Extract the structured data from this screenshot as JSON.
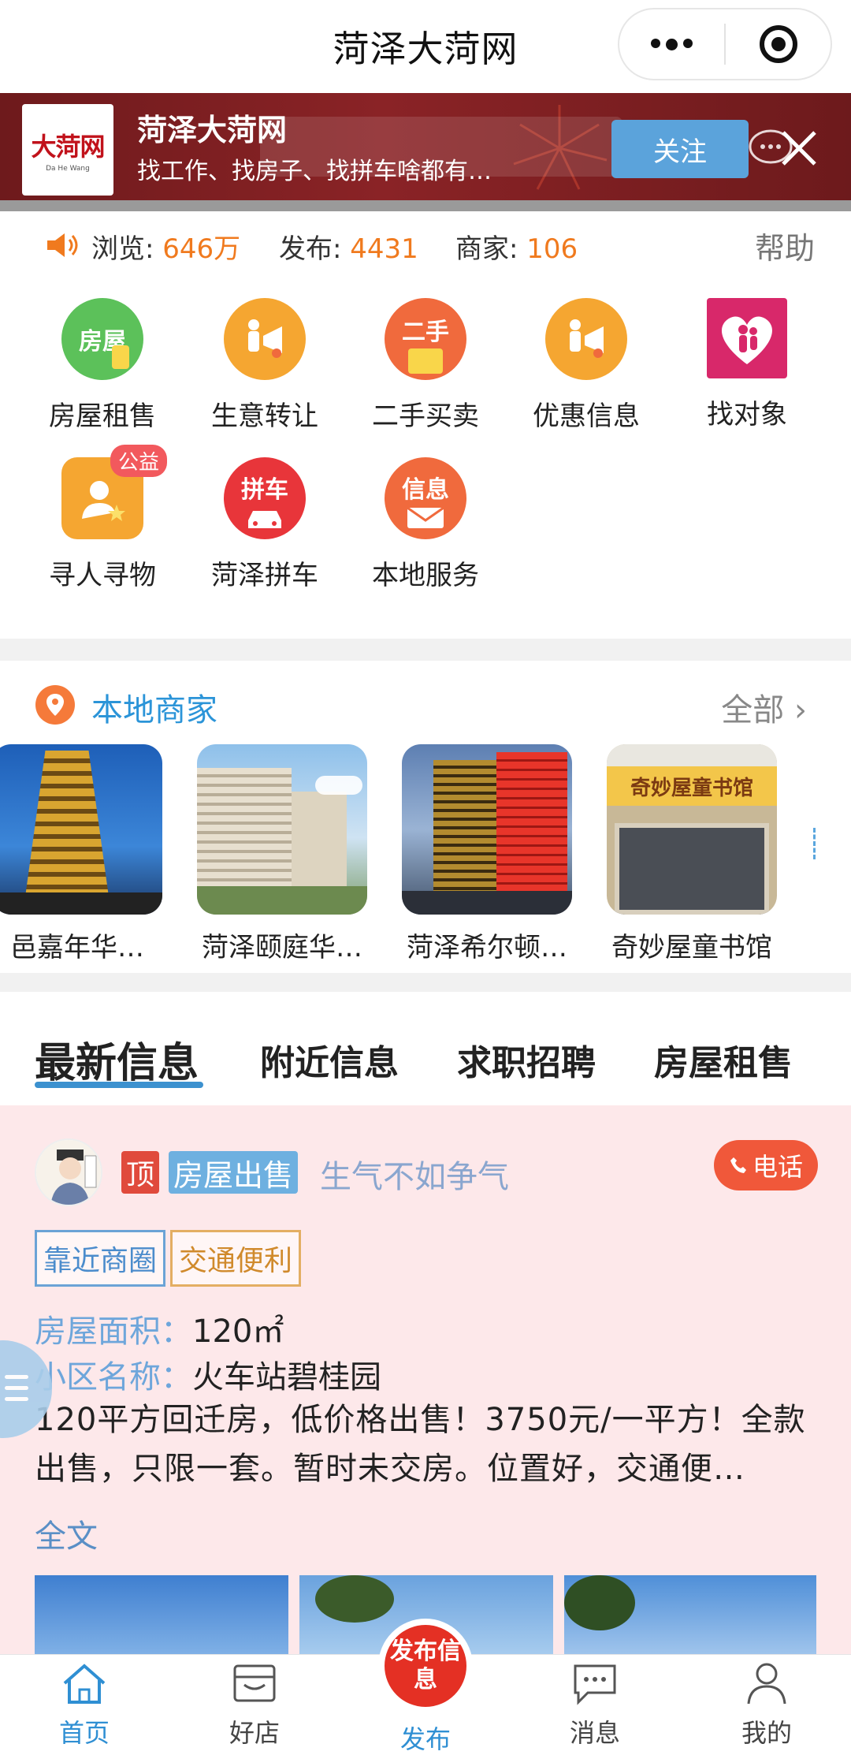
{
  "app": {
    "title": "菏泽大菏网"
  },
  "banner": {
    "logo_text": "大菏网",
    "logo_sub": "Da He Wang",
    "title": "菏泽大菏网",
    "subtitle": "找工作、找房子、找拼车啥都有…",
    "follow_label": "关注"
  },
  "stats": {
    "views_label": "浏览:",
    "views_value": "646万",
    "posts_label": "发布:",
    "posts_value": "4431",
    "merchants_label": "商家:",
    "merchants_value": "106",
    "help_label": "帮助"
  },
  "categories": [
    {
      "icon_text": "房屋",
      "label": "房屋租售",
      "color": "#5cc15a"
    },
    {
      "icon_text": "",
      "label": "生意转让",
      "color": "#f5a631"
    },
    {
      "icon_text": "二手",
      "label": "二手买卖",
      "color": "#f06a3d"
    },
    {
      "icon_text": "",
      "label": "优惠信息",
      "color": "#f5a631"
    },
    {
      "icon_text": "",
      "label": "找对象",
      "color": "#d8286a"
    },
    {
      "icon_text": "",
      "label": "寻人寻物",
      "badge": "公益",
      "color": "#f5a631"
    },
    {
      "icon_text": "拼车",
      "label": "菏泽拼车",
      "color": "#e8353a"
    },
    {
      "icon_text": "信息",
      "label": "本地服务",
      "color": "#f06a3d"
    }
  ],
  "merchants": {
    "title": "本地商家",
    "all_label": "全部 ›",
    "items": [
      {
        "name": "邑嘉年华…"
      },
      {
        "name": "菏泽颐庭华…"
      },
      {
        "name": "菏泽希尔顿…"
      },
      {
        "name": "奇妙屋童书馆",
        "sign_text": "奇妙屋童书馆"
      }
    ]
  },
  "tabs": [
    "最新信息",
    "附近信息",
    "求职招聘",
    "房屋租售"
  ],
  "post": {
    "top_tag": "顶",
    "category_tag": "房屋出售",
    "nickname": "生气不如争气",
    "call_label": "电话",
    "tags": [
      "靠近商圈",
      "交通便利"
    ],
    "fields": [
      {
        "key": "房屋面积：",
        "value": "120㎡"
      },
      {
        "key": "小区名称：",
        "value": "火车站碧桂园"
      }
    ],
    "description": "120平方回迁房，低价格出售！3750元/一平方！全款出售，只限一套。暂时未交房。位置好，交通便…",
    "full_text_label": "全文"
  },
  "nav": {
    "home": "首页",
    "shops": "好店",
    "publish_button": "发布信息",
    "publish": "发布",
    "messages": "消息",
    "mine": "我的"
  }
}
